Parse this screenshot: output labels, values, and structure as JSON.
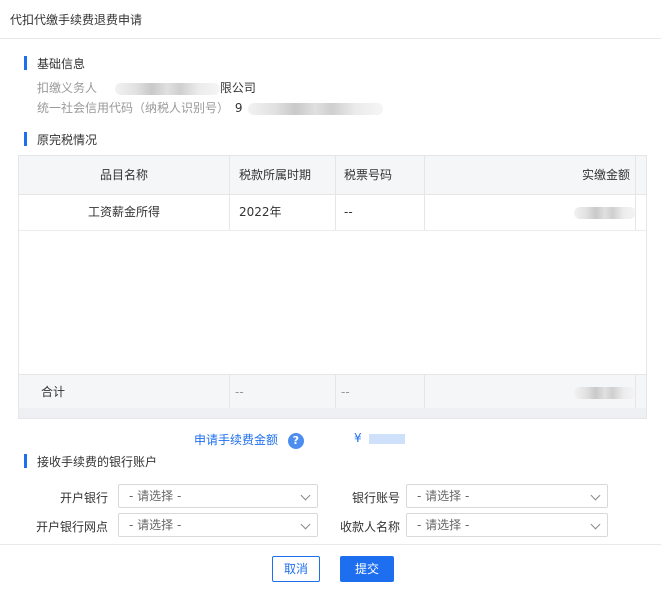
{
  "window": {
    "title": "代扣代缴手续费退费申请"
  },
  "basic_info": {
    "heading": "基础信息",
    "withholder_label": "扣缴义务人",
    "withholder_value_suffix": "限公司",
    "credit_code_label": "统一社会信用代码（纳税人识别号）",
    "credit_code_prefix": "9"
  },
  "tax_section": {
    "heading": "原完税情况",
    "columns": [
      "品目名称",
      "税款所属时期",
      "税票号码",
      "实缴金额"
    ],
    "rows": [
      {
        "item": "工资薪金所得",
        "period": "2022年",
        "ticket": "--"
      }
    ],
    "total": {
      "label": "合计",
      "period": "--",
      "ticket": "--"
    }
  },
  "fee": {
    "label": "申请手续费金额",
    "help_icon": "?",
    "currency": "¥"
  },
  "bank_section": {
    "heading": "接收手续费的银行账户",
    "fields": {
      "bank": {
        "label": "开户银行",
        "placeholder": "- 请选择 -"
      },
      "account": {
        "label": "银行账号",
        "placeholder": "- 请选择 -"
      },
      "branch": {
        "label": "开户银行网点",
        "placeholder": "- 请选择 -"
      },
      "payee": {
        "label": "收款人名称",
        "placeholder": "- 请选择 -"
      }
    }
  },
  "actions": {
    "cancel": "取消",
    "submit": "提交"
  },
  "colors": {
    "accent": "#1e6ff0",
    "help_icon": "#4d8df0"
  }
}
